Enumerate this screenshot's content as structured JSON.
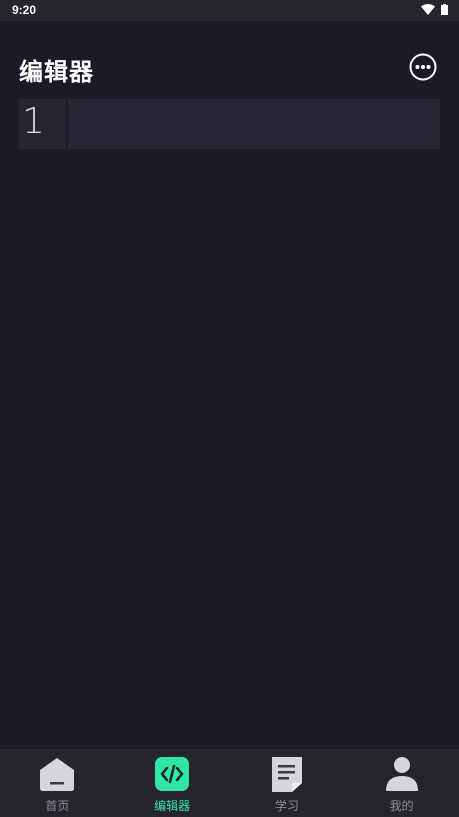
{
  "status_bar": {
    "time": "9:20"
  },
  "header": {
    "title": "编辑器",
    "more_icon": "more-horizontal-circle"
  },
  "editor": {
    "lines": [
      {
        "number": "1",
        "content": ""
      }
    ]
  },
  "bottom_nav": {
    "items": [
      {
        "label": "首页",
        "icon": "home-icon",
        "active": false
      },
      {
        "label": "编辑器",
        "icon": "code-icon",
        "active": true
      },
      {
        "label": "学习",
        "icon": "document-icon",
        "active": false
      },
      {
        "label": "我的",
        "icon": "user-icon",
        "active": false
      }
    ]
  },
  "colors": {
    "background": "#1b1b25",
    "accent": "#2ee6a6",
    "inactive": "#8f8f98"
  }
}
